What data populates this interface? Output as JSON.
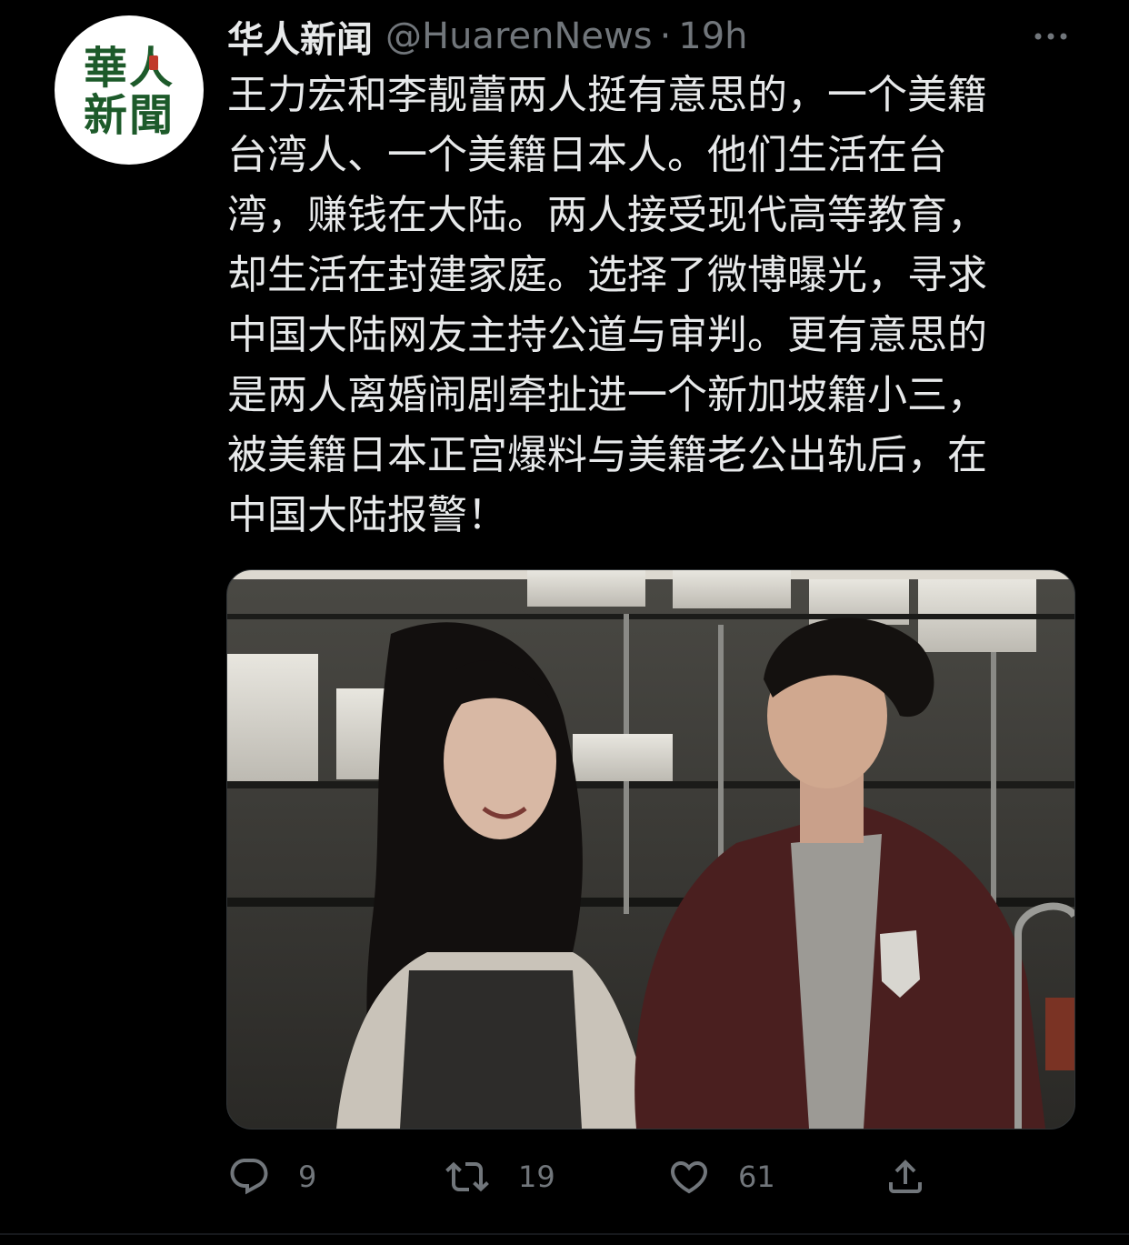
{
  "tweet": {
    "avatar_text_line1": "華人",
    "avatar_text_line2": "新聞",
    "display_name": "华人新闻",
    "handle": "@HuarenNews",
    "separator": "·",
    "time": "19h",
    "text_lines": [
      "王力宏和李靓蕾两人挺有意思的，一个美籍",
      "台湾人、一个美籍日本人。他们生活在台",
      "湾，赚钱在大陆。两人接受现代高等教育，",
      "却生活在封建家庭。选择了微博曝光，寻求",
      "中国大陆网友主持公道与审判。更有意思的",
      "是两人离婚闹剧牵扯进一个新加坡籍小三，",
      "被美籍日本正宫爆料与美籍老公出轨后，在",
      "中国大陆报警！"
    ]
  },
  "actions": {
    "reply_count": "9",
    "retweet_count": "19",
    "like_count": "61"
  },
  "icons": [
    "more-icon",
    "reply-icon",
    "retweet-icon",
    "like-icon",
    "share-icon"
  ],
  "colors": {
    "background": "#000000",
    "text": "#e7e9ea",
    "secondary": "#71767b",
    "avatar_logo": "#1d5a2a"
  }
}
